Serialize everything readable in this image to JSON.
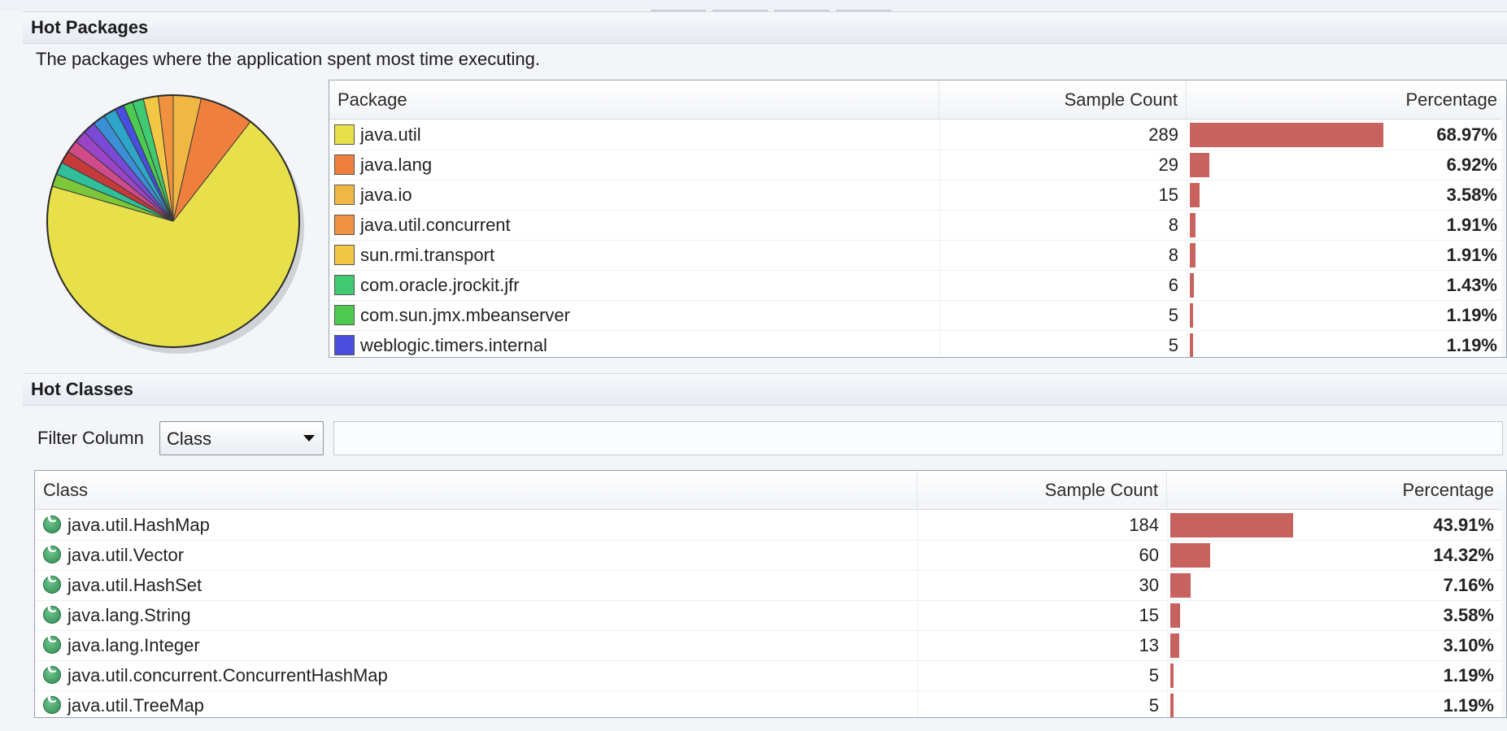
{
  "hot_packages": {
    "title": "Hot Packages",
    "description": "The packages where the application spent most time executing.",
    "columns": {
      "name": "Package",
      "count": "Sample Count",
      "pct": "Percentage"
    },
    "rows": [
      {
        "name": "java.util",
        "count": "289",
        "pct": "68.97%",
        "fraction": 0.6897,
        "color": "#e8e04a"
      },
      {
        "name": "java.lang",
        "count": "29",
        "pct": "6.92%",
        "fraction": 0.0692,
        "color": "#ef7f3c"
      },
      {
        "name": "java.io",
        "count": "15",
        "pct": "3.58%",
        "fraction": 0.0358,
        "color": "#f0b743"
      },
      {
        "name": "java.util.concurrent",
        "count": "8",
        "pct": "1.91%",
        "fraction": 0.0191,
        "color": "#f0913f"
      },
      {
        "name": "sun.rmi.transport",
        "count": "8",
        "pct": "1.91%",
        "fraction": 0.0191,
        "color": "#f2c744"
      },
      {
        "name": "com.oracle.jrockit.jfr",
        "count": "6",
        "pct": "1.43%",
        "fraction": 0.0143,
        "color": "#3fc970"
      },
      {
        "name": "com.sun.jmx.mbeanserver",
        "count": "5",
        "pct": "1.19%",
        "fraction": 0.0119,
        "color": "#4ccb50"
      },
      {
        "name": "weblogic.timers.internal",
        "count": "5",
        "pct": "1.19%",
        "fraction": 0.0119,
        "color": "#4a4ee0"
      }
    ],
    "pie_other_colors": [
      "#2fa6c9",
      "#3a8fd6",
      "#7a4ad6",
      "#9a44c6",
      "#d14a8a",
      "#c63a3a",
      "#2fbf9a",
      "#7cc63a"
    ]
  },
  "hot_classes": {
    "title": "Hot Classes",
    "filter": {
      "label": "Filter Column",
      "selected": "Class",
      "text": ""
    },
    "columns": {
      "name": "Class",
      "count": "Sample Count",
      "pct": "Percentage"
    },
    "rows": [
      {
        "name": "java.util.HashMap",
        "count": "184",
        "pct": "43.91%",
        "fraction": 0.4391
      },
      {
        "name": "java.util.Vector",
        "count": "60",
        "pct": "14.32%",
        "fraction": 0.1432
      },
      {
        "name": "java.util.HashSet",
        "count": "30",
        "pct": "7.16%",
        "fraction": 0.0716
      },
      {
        "name": "java.lang.String",
        "count": "15",
        "pct": "3.58%",
        "fraction": 0.0358
      },
      {
        "name": "java.lang.Integer",
        "count": "13",
        "pct": "3.10%",
        "fraction": 0.031
      },
      {
        "name": "java.util.concurrent.ConcurrentHashMap",
        "count": "5",
        "pct": "1.19%",
        "fraction": 0.0119
      },
      {
        "name": "java.util.TreeMap",
        "count": "5",
        "pct": "1.19%",
        "fraction": 0.0119
      }
    ],
    "bar_color": "#c8625e"
  }
}
